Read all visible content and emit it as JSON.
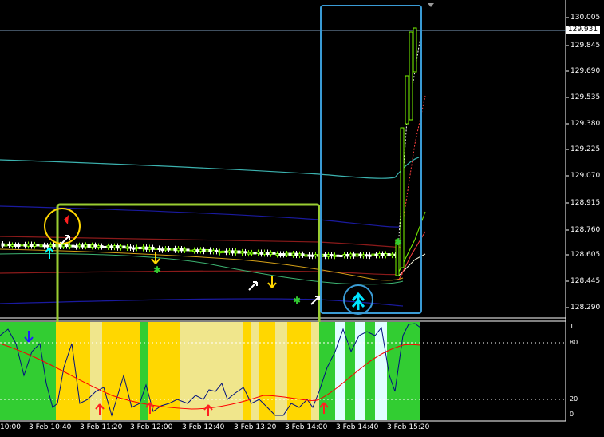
{
  "main_chart": {
    "price_ticks": [
      "130.005",
      "129.845",
      "129.690",
      "129.535",
      "129.380",
      "129.225",
      "129.070",
      "128.915",
      "128.760",
      "128.605",
      "128.445",
      "128.290"
    ],
    "current_price": "129.931",
    "time_ticks": [
      "10:00",
      "3 Feb 10:40",
      "3 Feb 11:20",
      "3 Feb 12:00",
      "3 Feb 12:40",
      "3 Feb 13:20",
      "3 Feb 14:00",
      "3 Feb 14:40",
      "3 Feb 15:20"
    ]
  },
  "indicator": {
    "levels": [
      "1",
      "80",
      "20",
      "0"
    ]
  },
  "colors": {
    "background": "#000000",
    "grid": "#7f7f7f",
    "up_candle": "#7cfc00",
    "down_candle": "#ffffff",
    "ma_cyan": "#3cb3b0",
    "ma_blue": "#1a1aa0",
    "ma_red": "#8b1a1a",
    "highlight_green": "#9acd32",
    "highlight_blue": "#3a9bd5",
    "zone_green": "#32cd32",
    "zone_gold": "#ffd700",
    "zone_pale": "#f0e68c",
    "zone_cyan": "#e0ffff",
    "stoch_line": "#001080",
    "signal_line": "#ff0000"
  },
  "icons": [
    "up-arrow-icon",
    "down-arrow-icon",
    "star-icon",
    "double-up-arrow-icon"
  ]
}
